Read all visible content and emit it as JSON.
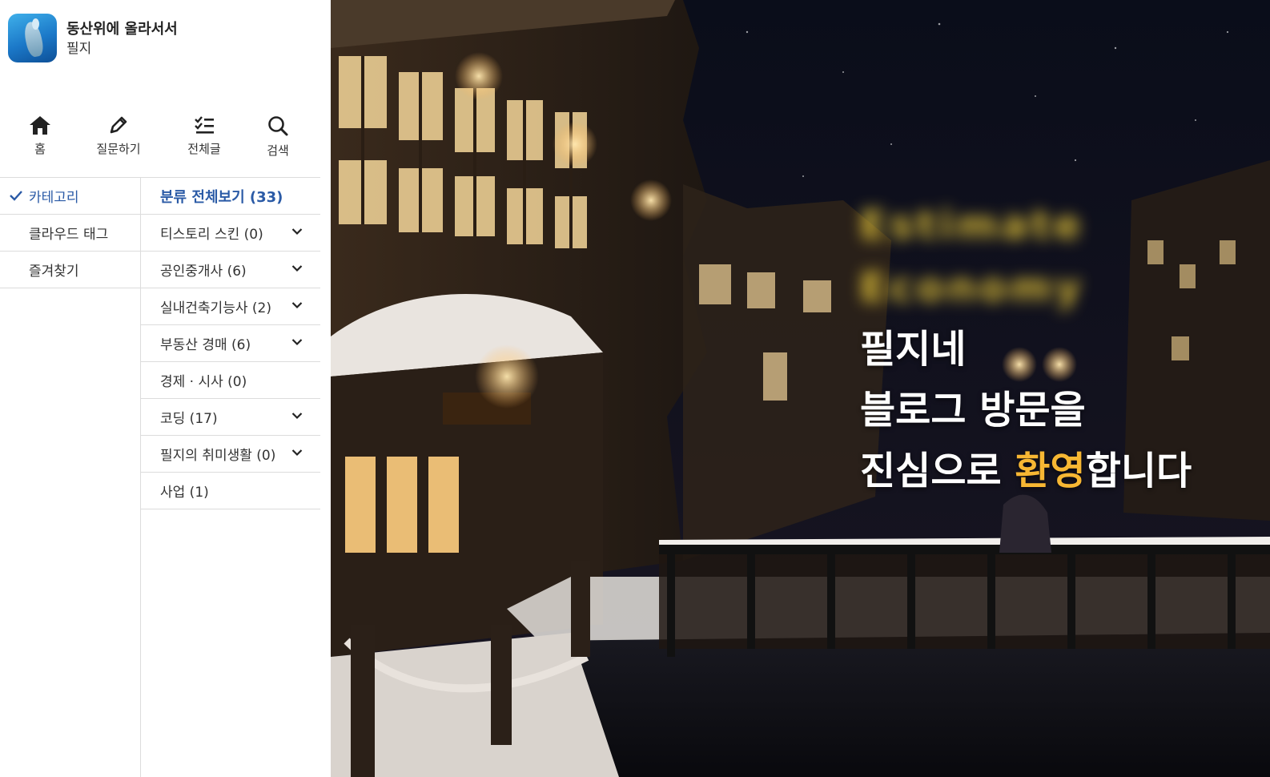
{
  "blog": {
    "title": "동산위에 올라서서",
    "author": "필지"
  },
  "nav": [
    {
      "label": "홈",
      "icon": "home-icon"
    },
    {
      "label": "질문하기",
      "icon": "pencil-icon"
    },
    {
      "label": "전체글",
      "icon": "list-check-icon"
    },
    {
      "label": "검색",
      "icon": "search-icon"
    }
  ],
  "tabs": [
    {
      "label": "카테고리",
      "active": true
    },
    {
      "label": "클라우드 태그",
      "active": false
    },
    {
      "label": "즐겨찾기",
      "active": false
    }
  ],
  "categories": {
    "all_label": "분류 전체보기 (33)",
    "items": [
      {
        "label": "티스토리 스킨 (0)",
        "expandable": true
      },
      {
        "label": "공인중개사 (6)",
        "expandable": true
      },
      {
        "label": "실내건축기능사 (2)",
        "expandable": true
      },
      {
        "label": "부동산 경매 (6)",
        "expandable": true
      },
      {
        "label": "경제 · 시사 (0)",
        "expandable": false
      },
      {
        "label": "코딩 (17)",
        "expandable": true
      },
      {
        "label": "필지의 취미생활 (0)",
        "expandable": true
      },
      {
        "label": "사업 (1)",
        "expandable": false
      }
    ]
  },
  "hero": {
    "blurred_line1": "Estimate",
    "blurred_line2": "Economy",
    "line1": "필지네",
    "line2": "블로그 방문을",
    "line3_pre": "진심으로 ",
    "line3_highlight": "환영",
    "line3_post": "합니다"
  },
  "colors": {
    "accent": "#2a5aa6",
    "highlight": "#f7b733",
    "divider": "#dcdcdc"
  }
}
